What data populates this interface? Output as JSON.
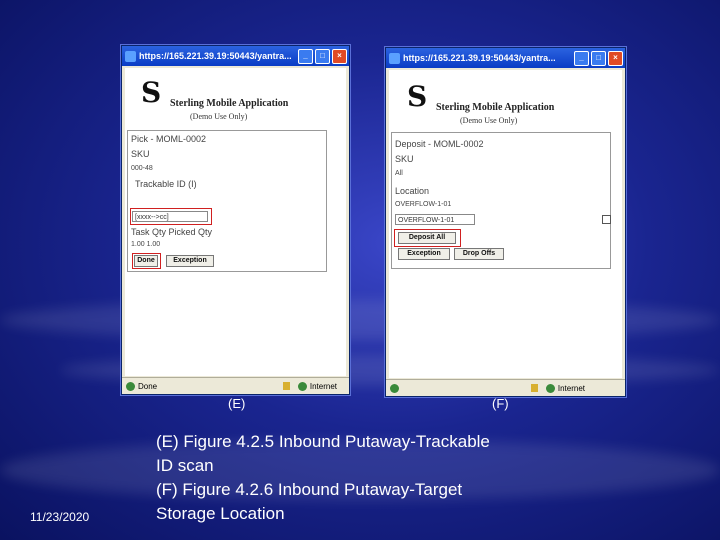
{
  "windows": {
    "e": {
      "title": "https://165.221.39.19:50443/yantra...",
      "app_title": "Sterling Mobile Application",
      "demo_note": "(Demo Use Only)",
      "fields": {
        "pick": "Pick -  MOML-0002",
        "sku": "SKU",
        "sku_value": "000-48",
        "trackable": "Trackable ID (I)",
        "scan_value": "[xxxx-->cc]",
        "task_qty": "Task Qty  Picked Qty",
        "qty_values": "1.00        1.00"
      },
      "buttons": {
        "done": "Done",
        "exception": "Exception"
      },
      "status": {
        "left": "Done",
        "right": "Internet"
      }
    },
    "f": {
      "title": "https://165.221.39.19:50443/yantra...",
      "app_title": "Sterling Mobile Application",
      "demo_note": "(Demo Use Only)",
      "fields": {
        "deposit": "Deposit -  MOML-0002",
        "sku": "SKU",
        "sku_value": "All",
        "location": "Location",
        "location_value": "OVERFLOW-1-01",
        "location_input": "OVERFLOW-1-01"
      },
      "buttons": {
        "deposit_all": "Deposit All",
        "exception": "Exception",
        "drop_offs": "Drop Offs"
      },
      "status": {
        "right": "Internet"
      }
    }
  },
  "labels": {
    "e": "(E)",
    "f": "(F)"
  },
  "caption": {
    "line1": "(E) Figure 4.2.5 Inbound Putaway-Trackable",
    "line2": "ID scan",
    "line3": "(F) Figure 4.2.6 Inbound Putaway-Target",
    "line4": "Storage Location"
  },
  "date": "11/23/2020"
}
